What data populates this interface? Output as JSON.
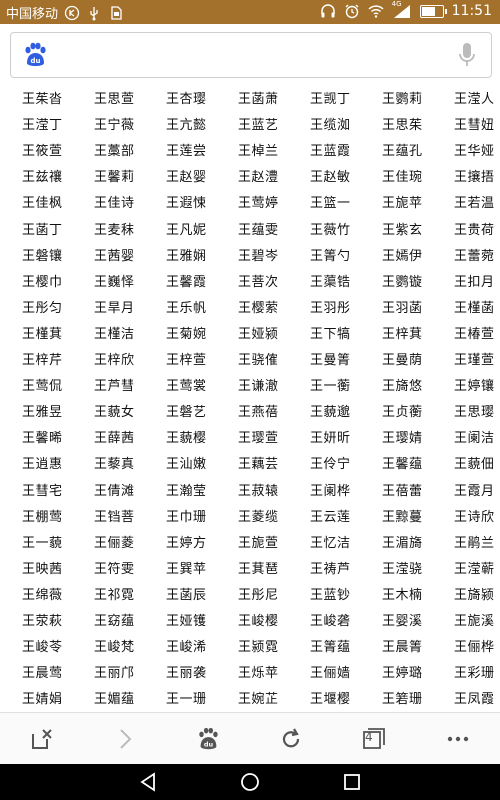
{
  "status_bar": {
    "carrier": "中国移动",
    "signal_type": "4G",
    "time": "11:51",
    "battery_level": 0.7,
    "icons": [
      "carrier-badge-icon",
      "usb-icon",
      "sim-icon",
      "headphones-icon",
      "alarm-icon",
      "wifi-icon",
      "signal-icon",
      "battery-icon"
    ]
  },
  "search": {
    "placeholder": "",
    "value": "",
    "logo_icon": "baidu-paw-icon",
    "mic_icon": "microphone-icon"
  },
  "names": [
    [
      "王茱沓",
      "王思萱",
      "王杏璎",
      "王菡萧",
      "王觊丁",
      "王鹦莉",
      "王滢人"
    ],
    [
      "王滢丁",
      "王宁薇",
      "王亢懿",
      "王蓝艺",
      "王缆洳",
      "王思茱",
      "王彗妞"
    ],
    [
      "王筱萱",
      "王藁部",
      "王莲尝",
      "王棹兰",
      "王蓝霞",
      "王蕴孔",
      "王华娅"
    ],
    [
      "王兹禳",
      "王馨莉",
      "王赵婴",
      "王赵澧",
      "王赵敏",
      "王佳琬",
      "王攘捂"
    ],
    [
      "王佳枫",
      "王佳诗",
      "王遐悚",
      "王莺婷",
      "王篮一",
      "王旎苹",
      "王若温"
    ],
    [
      "王菡丁",
      "王麦秣",
      "王凡妮",
      "王蕴雯",
      "王薇竹",
      "王紫玄",
      "王贵荷"
    ],
    [
      "王磐镶",
      "王茜婴",
      "王雅娴",
      "王碧岑",
      "王箐勺",
      "王嫣伊",
      "王蕾菀"
    ],
    [
      "王樱巾",
      "王巍怿",
      "王馨霞",
      "王菩次",
      "王蕖锆",
      "王鹦镟",
      "王扣月"
    ],
    [
      "王彤匀",
      "王旱月",
      "王乐帆",
      "王樱萦",
      "王羽彤",
      "王羽菡",
      "王槿菡"
    ],
    [
      "王槿萁",
      "王槿洁",
      "王菊婉",
      "王娅颍",
      "王下犒",
      "王梓萁",
      "王椿萱"
    ],
    [
      "王梓芹",
      "王梓欣",
      "王梓萱",
      "王骁傕",
      "王曼箐",
      "王曼荫",
      "王瑾萱"
    ],
    [
      "王莺侃",
      "王芦彗",
      "王莺裳",
      "王谦澈",
      "王一蘅",
      "王旖悠",
      "王婷镶"
    ],
    [
      "王雅昱",
      "王藐女",
      "王磐艺",
      "王燕蓓",
      "王藐邈",
      "王贞蘅",
      "王思璎"
    ],
    [
      "王馨晞",
      "王薛茜",
      "王藐樱",
      "王璎萱",
      "王妍昕",
      "王璎婧",
      "王阑洁"
    ],
    [
      "王逍惠",
      "王藜真",
      "王汕嫩",
      "王藕芸",
      "王伶宁",
      "王馨蕴",
      "王藐佃"
    ],
    [
      "王彗宅",
      "王倩滩",
      "王瀚莹",
      "王菽辕",
      "王阑桦",
      "王蓓蕾",
      "王霞月"
    ],
    [
      "王棚莺",
      "王铛菩",
      "王巾珊",
      "王菱缆",
      "王云莲",
      "王黥蔓",
      "王诗欣"
    ],
    [
      "王一藐",
      "王俪菱",
      "王婷方",
      "王旎萱",
      "王忆洁",
      "王湄旖",
      "王鹃兰"
    ],
    [
      "王映茜",
      "王符雯",
      "王巽苹",
      "王萁琶",
      "王祷芦",
      "王滢骁",
      "王滢蕲"
    ],
    [
      "王绵薇",
      "王祁霓",
      "王菡辰",
      "王彤尼",
      "王蓝钞",
      "王木楠",
      "王旖颍"
    ],
    [
      "王荥萩",
      "王窈蕴",
      "王娅镬",
      "王峻樱",
      "王峻砻",
      "王婴溪",
      "王旎溪"
    ],
    [
      "王峻苓",
      "王峻梵",
      "王峻浠",
      "王颍霓",
      "王箐蕴",
      "王晨箐",
      "王俪桦"
    ],
    [
      "王晨莺",
      "王丽邝",
      "王丽袭",
      "王烁苹",
      "王俪嫱",
      "王婷璐",
      "王彩珊"
    ],
    [
      "王婧娟",
      "王媚蕴",
      "王一珊",
      "王婉芷",
      "王堰樱",
      "王箬珊",
      "王凤霞"
    ]
  ],
  "toolbar": {
    "tab_count": "4",
    "icons": [
      "close-page-icon",
      "forward-icon",
      "baidu-home-icon",
      "refresh-icon",
      "tabs-icon",
      "more-icon"
    ]
  },
  "navbar": {
    "icons": [
      "back-triangle-icon",
      "home-circle-icon",
      "recents-square-icon"
    ]
  }
}
